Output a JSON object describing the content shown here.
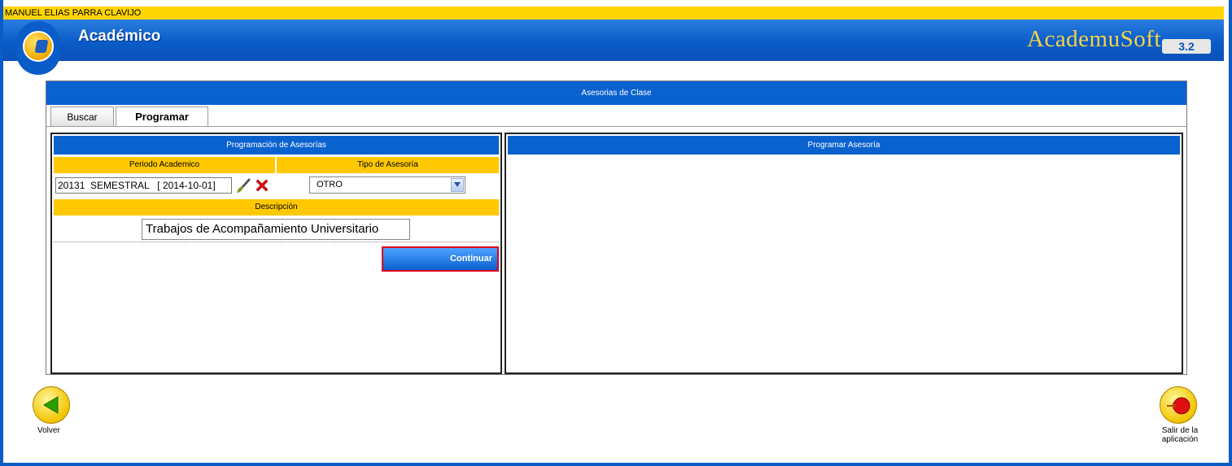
{
  "user": {
    "name": "MANUEL ELIAS PARRA CLAVIJO"
  },
  "header": {
    "title": "Académico",
    "brand": "AcademuSoft",
    "version": "3.2"
  },
  "panel": {
    "title": "Asesorias de Clase",
    "tabs": [
      {
        "label": "Buscar"
      },
      {
        "label": "Programar"
      }
    ]
  },
  "left": {
    "title": "Programación de Asesorías",
    "periodo_label": "Periodo Academico",
    "periodo_value": "20131  SEMESTRAL   [ 2014-10-01]",
    "tipo_label": "Tipo de Asesoría",
    "tipo_value": "OTRO",
    "descripcion_label": "Descripción",
    "descripcion_value": "Trabajos de Acompañamiento Universitario",
    "continuar_label": "Continuar"
  },
  "right": {
    "title": "Programar Asesoría"
  },
  "footer": {
    "volver_label": "Volver",
    "salir_line1": "Salir de la",
    "salir_line2": "aplicación"
  },
  "colors": {
    "blue": "#0a62cf",
    "yellow": "#ffc800",
    "highlight": "#e0001b"
  }
}
